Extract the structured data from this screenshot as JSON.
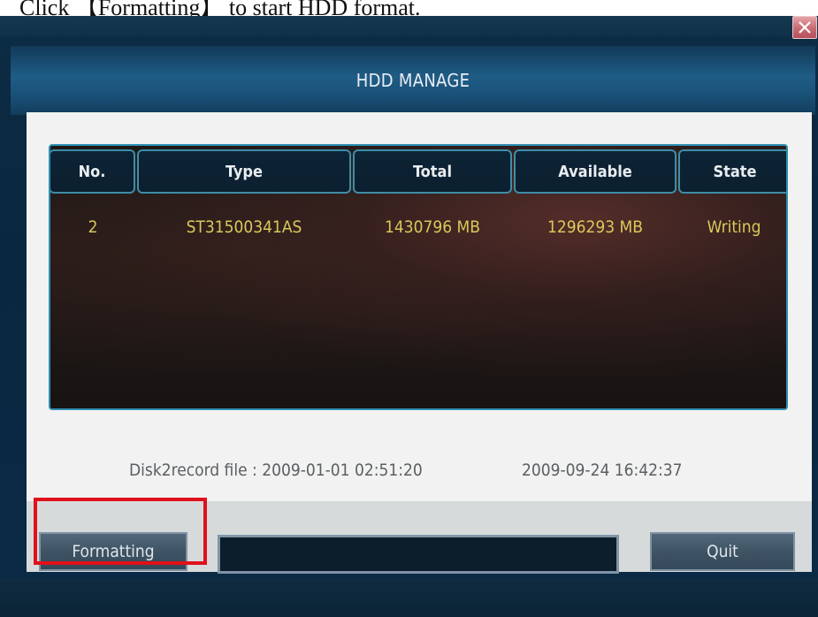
{
  "caption": {
    "text": "Click 【Formatting】 to start HDD format."
  },
  "window": {
    "title": "HDD MANAGE",
    "close_icon": "close-icon"
  },
  "table": {
    "columns": [
      "No.",
      "Type",
      "Total",
      "Available",
      "State"
    ],
    "rows": [
      {
        "no": "2",
        "type": "ST31500341AS",
        "total": "1430796 MB",
        "available": "1296293 MB",
        "state": "Writing"
      }
    ]
  },
  "record": {
    "label": "Disk2record file : 2009-01-01 02:51:20",
    "end": "2009-09-24 16:42:37"
  },
  "buttons": {
    "formatting": "Formatting",
    "quit": "Quit"
  },
  "progress": {
    "value": 0
  },
  "colors": {
    "accent_blue": "#1f5c86",
    "table_text": "#d8c85a",
    "highlight": "#e0101a"
  }
}
